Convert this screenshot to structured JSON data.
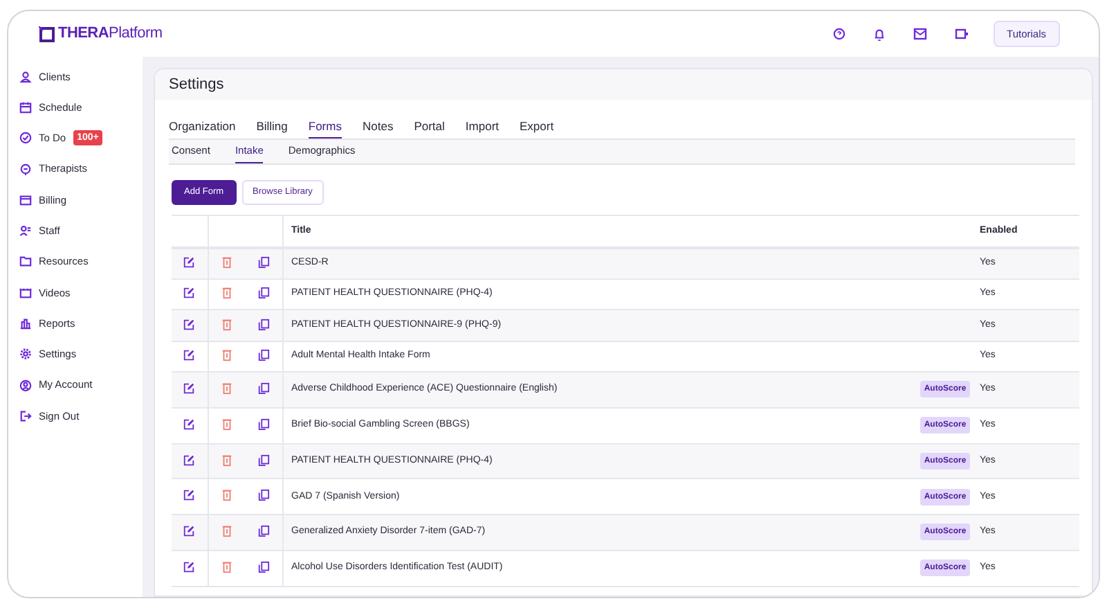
{
  "logo": "**THERA**Platform",
  "header": {
    "tutorials_button": "Tutorials"
  },
  "sidebar": {
    "items": [
      {
        "label": "Clients"
      },
      {
        "label": "Schedule"
      },
      {
        "label": "To Do",
        "badge": "100+"
      },
      {
        "label": "Therapists"
      },
      {
        "label": "Billing"
      },
      {
        "label": "Staff"
      },
      {
        "label": "Resources"
      },
      {
        "label": "Videos"
      },
      {
        "label": "Reports"
      },
      {
        "label": "Settings"
      },
      {
        "label": "My Account"
      },
      {
        "label": "Sign Out"
      }
    ]
  },
  "page_title": "Settings",
  "tabs": [
    {
      "label": "Organization",
      "selected": false
    },
    {
      "label": "Billing",
      "selected": false
    },
    {
      "label": "Forms",
      "selected": true
    },
    {
      "label": "Notes",
      "selected": false
    },
    {
      "label": "Portal",
      "selected": false
    },
    {
      "label": "Import",
      "selected": false
    },
    {
      "label": "Export",
      "selected": false
    }
  ],
  "subtabs": [
    {
      "label": "Consent",
      "selected": false
    },
    {
      "label": "Intake",
      "selected": true
    },
    {
      "label": "Demographics",
      "selected": false
    }
  ],
  "buttons": {
    "add": "Add Form",
    "browse": "Browse Library"
  },
  "table": {
    "columns": [
      "Title",
      "Enabled"
    ],
    "rows": [
      {
        "title": "CESD-R",
        "enabled": "Yes"
      },
      {
        "title": "PATIENT HEALTH QUESTIONNAIRE (PHQ-4)",
        "enabled": "Yes"
      },
      {
        "title": "PATIENT HEALTH QUESTIONNAIRE-9 (PHQ-9)",
        "enabled": "Yes"
      },
      {
        "title": "Adult Mental Health Intake Form",
        "enabled": "Yes"
      },
      {
        "title": "Adverse Childhood Experience (ACE) Questionnaire (English)",
        "badge": "AutoScore",
        "enabled": "Yes"
      },
      {
        "title": "Brief Bio-social Gambling Screen (BBGS)",
        "badge": "AutoScore",
        "enabled": "Yes"
      },
      {
        "title": "PATIENT HEALTH QUESTIONNAIRE (PHQ-4)",
        "badge": "AutoScore",
        "enabled": "Yes"
      },
      {
        "title": "GAD 7 (Spanish Version)",
        "badge": "AutoScore",
        "enabled": "Yes"
      },
      {
        "title": "Generalized Anxiety Disorder 7-item (GAD-7)",
        "badge": "AutoScore",
        "enabled": "Yes"
      },
      {
        "title": "Alcohol Use Disorders Identification Test (AUDIT)",
        "badge": "AutoScore",
        "enabled": "Yes"
      }
    ]
  }
}
